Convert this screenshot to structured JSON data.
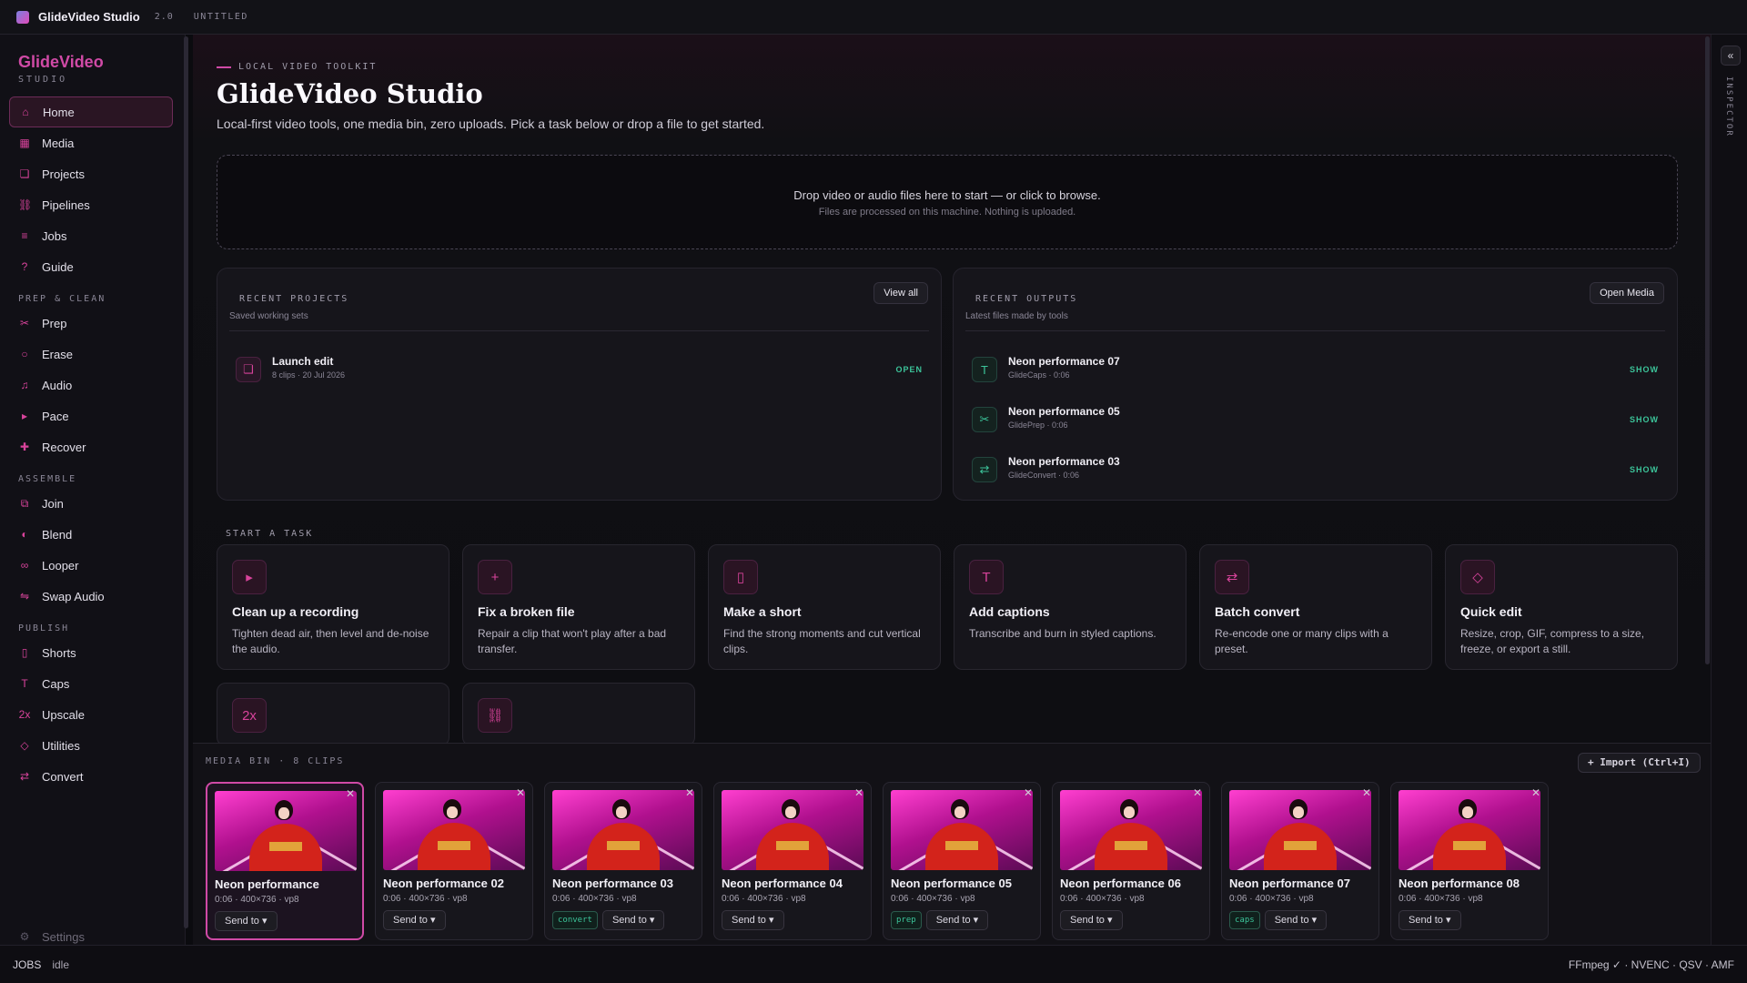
{
  "titlebar": {
    "app_name": "GlideVideo Studio",
    "version": "2.0",
    "document": "UNTITLED"
  },
  "sidebar": {
    "brand": "GlideVideo",
    "brand_sub": "STUDIO",
    "top_items": [
      {
        "label": "Home",
        "icon": "home-icon",
        "active": true
      },
      {
        "label": "Media",
        "icon": "media-icon"
      },
      {
        "label": "Projects",
        "icon": "projects-icon"
      },
      {
        "label": "Pipelines",
        "icon": "pipelines-icon"
      },
      {
        "label": "Jobs",
        "icon": "jobs-icon"
      },
      {
        "label": "Guide",
        "icon": "guide-icon"
      }
    ],
    "groups": [
      {
        "title": "PREP & CLEAN",
        "items": [
          {
            "label": "Prep",
            "icon": "scissors-icon"
          },
          {
            "label": "Erase",
            "icon": "erase-icon"
          },
          {
            "label": "Audio",
            "icon": "music-note-icon"
          },
          {
            "label": "Pace",
            "icon": "play-icon"
          },
          {
            "label": "Recover",
            "icon": "plus-icon"
          }
        ]
      },
      {
        "title": "ASSEMBLE",
        "items": [
          {
            "label": "Join",
            "icon": "join-icon"
          },
          {
            "label": "Blend",
            "icon": "blend-icon"
          },
          {
            "label": "Looper",
            "icon": "infinity-icon"
          },
          {
            "label": "Swap Audio",
            "icon": "swap-icon"
          }
        ]
      },
      {
        "title": "PUBLISH",
        "items": [
          {
            "label": "Shorts",
            "icon": "phone-icon"
          },
          {
            "label": "Caps",
            "icon": "text-icon"
          },
          {
            "label": "Upscale",
            "icon": "upscale-2x-icon"
          },
          {
            "label": "Utilities",
            "icon": "diamond-icon"
          },
          {
            "label": "Convert",
            "icon": "convert-icon"
          }
        ]
      }
    ],
    "settings_label": "Settings"
  },
  "main": {
    "kicker": "LOCAL VIDEO TOOLKIT",
    "title": "GlideVideo Studio",
    "subtitle": "Local-first video tools, one media bin, zero uploads. Pick a task below or drop a file to get started.",
    "drop": {
      "primary": "Drop video or audio files here to start — or click to browse.",
      "secondary": "Files are processed on this machine. Nothing is uploaded."
    },
    "recent_projects": {
      "title": "RECENT PROJECTS",
      "subtitle": "Saved working sets",
      "button": "View all",
      "items": [
        {
          "name": "Launch edit",
          "meta": "8 clips · 20 Jul 2026",
          "action": "OPEN"
        }
      ]
    },
    "recent_outputs": {
      "title": "RECENT OUTPUTS",
      "subtitle": "Latest files made by tools",
      "button": "Open Media",
      "items": [
        {
          "name": "Neon performance 07",
          "meta": "GlideCaps · 0:06",
          "action": "SHOW",
          "icon": "text-icon",
          "glyph": "T"
        },
        {
          "name": "Neon performance 05",
          "meta": "GlidePrep · 0:06",
          "action": "SHOW",
          "icon": "scissors-icon",
          "glyph": "✂"
        },
        {
          "name": "Neon performance 03",
          "meta": "GlideConvert · 0:06",
          "action": "SHOW",
          "icon": "convert-icon",
          "glyph": "⇄"
        }
      ]
    },
    "tasks_title": "START A TASK",
    "tasks": [
      {
        "title": "Clean up a recording",
        "desc": "Tighten dead air, then level and de-noise the audio.",
        "icon": "play-icon",
        "glyph": "▸"
      },
      {
        "title": "Fix a broken file",
        "desc": "Repair a clip that won't play after a bad transfer.",
        "icon": "plus-icon",
        "glyph": "+"
      },
      {
        "title": "Make a short",
        "desc": "Find the strong moments and cut vertical clips.",
        "icon": "phone-icon",
        "glyph": "▯"
      },
      {
        "title": "Add captions",
        "desc": "Transcribe and burn in styled captions.",
        "icon": "text-icon",
        "glyph": "T"
      },
      {
        "title": "Batch convert",
        "desc": "Re-encode one or many clips with a preset.",
        "icon": "convert-icon",
        "glyph": "⇄"
      },
      {
        "title": "Quick edit",
        "desc": "Resize, crop, GIF, compress to a size, freeze, or export a still.",
        "icon": "diamond-icon",
        "glyph": "◇"
      }
    ],
    "tasks_row2": [
      {
        "icon": "upscale-2x-icon",
        "glyph": "2x"
      },
      {
        "icon": "pipelines-icon",
        "glyph": "⛓"
      }
    ]
  },
  "media_bin": {
    "title": "MEDIA BIN · 8 CLIPS",
    "import_label": "+ Import (Ctrl+I)",
    "send_label": "Send to ▾",
    "clips": [
      {
        "name": "Neon performance",
        "meta": "0:06 · 400×736 · vp8",
        "tag": ""
      },
      {
        "name": "Neon performance 02",
        "meta": "0:06 · 400×736 · vp8",
        "tag": ""
      },
      {
        "name": "Neon performance 03",
        "meta": "0:06 · 400×736 · vp8",
        "tag": "convert"
      },
      {
        "name": "Neon performance 04",
        "meta": "0:06 · 400×736 · vp8",
        "tag": ""
      },
      {
        "name": "Neon performance 05",
        "meta": "0:06 · 400×736 · vp8",
        "tag": "prep"
      },
      {
        "name": "Neon performance 06",
        "meta": "0:06 · 400×736 · vp8",
        "tag": ""
      },
      {
        "name": "Neon performance 07",
        "meta": "0:06 · 400×736 · vp8",
        "tag": "caps"
      },
      {
        "name": "Neon performance 08",
        "meta": "0:06 · 400×736 · vp8",
        "tag": ""
      }
    ]
  },
  "inspector": {
    "label": "INSPECTOR",
    "toggle": "«"
  },
  "status": {
    "jobs_label": "JOBS",
    "state": "idle",
    "capabilities": "FFmpeg ✓ · NVENC · QSV · AMF"
  },
  "colors": {
    "accent": "#d04aa6",
    "success": "#3cc49a",
    "background": "#0b0b0f"
  }
}
